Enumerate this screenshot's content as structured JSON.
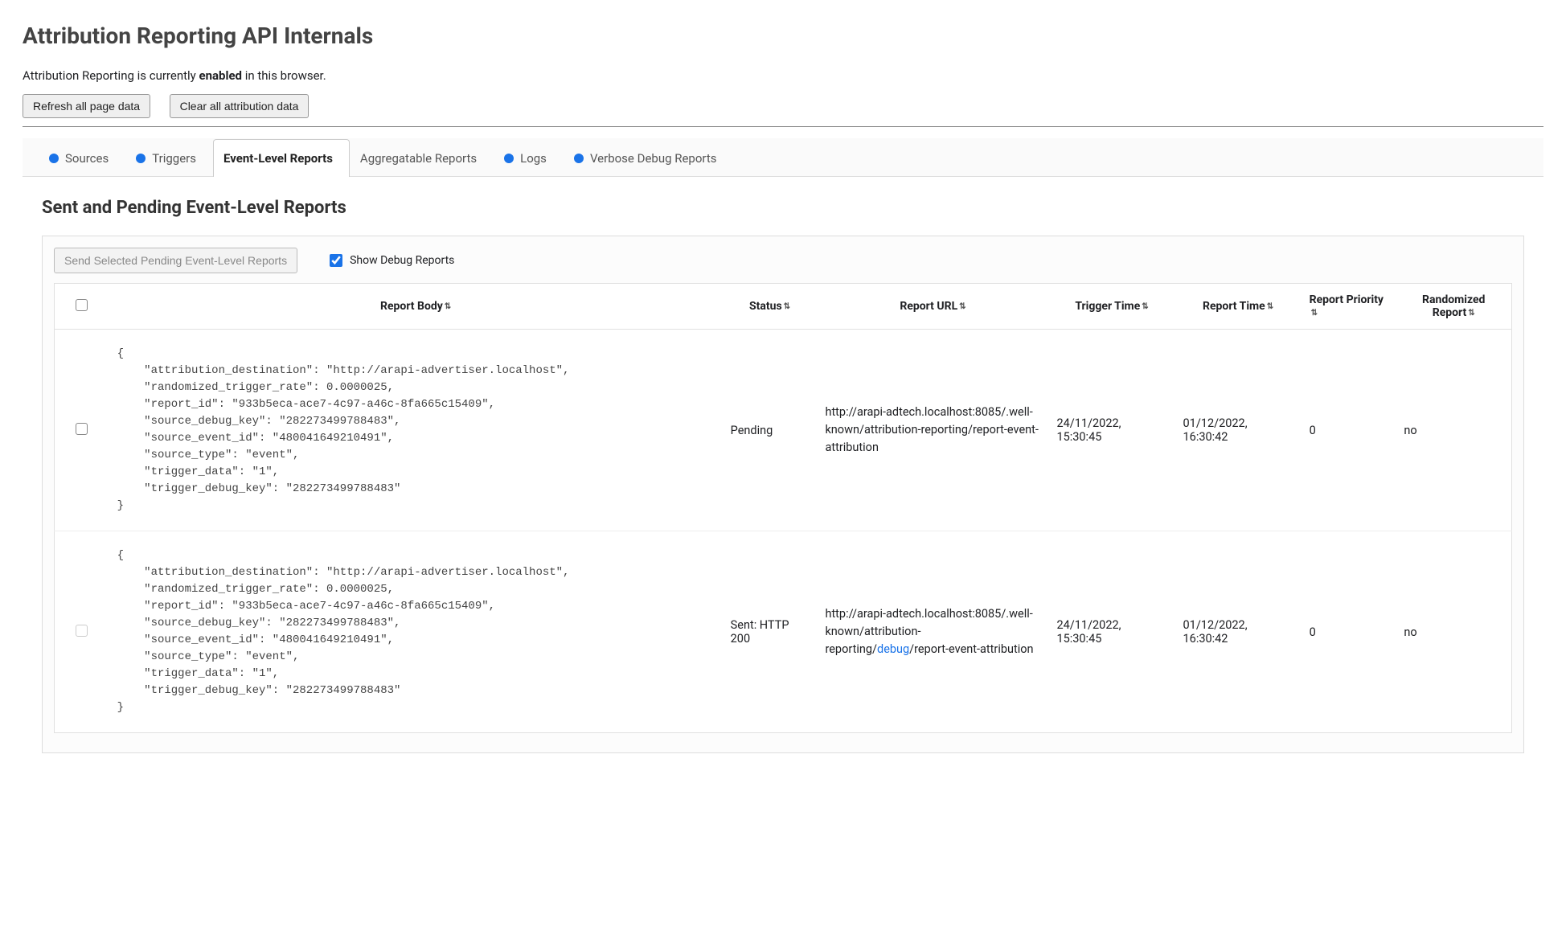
{
  "page": {
    "title": "Attribution Reporting API Internals",
    "status_prefix": "Attribution Reporting is currently ",
    "status_word": "enabled",
    "status_suffix": " in this browser.",
    "refresh_btn": "Refresh all page data",
    "clear_btn": "Clear all attribution data"
  },
  "tabs": {
    "sources": "Sources",
    "triggers": "Triggers",
    "event_reports": "Event-Level Reports",
    "agg_reports": "Aggregatable Reports",
    "logs": "Logs",
    "verbose": "Verbose Debug Reports"
  },
  "section": {
    "heading": "Sent and Pending Event-Level Reports",
    "send_btn": "Send Selected Pending Event-Level Reports",
    "show_debug_label": "Show Debug Reports"
  },
  "table": {
    "headers": {
      "body": "Report Body",
      "status": "Status",
      "url": "Report URL",
      "trigger_time": "Trigger Time",
      "report_time": "Report Time",
      "priority": "Report Priority",
      "randomized": "Randomized Report"
    },
    "rows": [
      {
        "checkbox_disabled": false,
        "body": "{\n    \"attribution_destination\": \"http://arapi-advertiser.localhost\",\n    \"randomized_trigger_rate\": 0.0000025,\n    \"report_id\": \"933b5eca-ace7-4c97-a46c-8fa665c15409\",\n    \"source_debug_key\": \"282273499788483\",\n    \"source_event_id\": \"480041649210491\",\n    \"source_type\": \"event\",\n    \"trigger_data\": \"1\",\n    \"trigger_debug_key\": \"282273499788483\"\n}",
        "status": "Pending",
        "url_pre": "http://arapi-adtech.localhost:8085/.well-known/attribution-reporting/report-event-attribution",
        "url_debug": "",
        "url_post": "",
        "trigger_time": "24/11/2022, 15:30:45",
        "report_time": "01/12/2022, 16:30:42",
        "priority": "0",
        "randomized": "no"
      },
      {
        "checkbox_disabled": true,
        "body": "{\n    \"attribution_destination\": \"http://arapi-advertiser.localhost\",\n    \"randomized_trigger_rate\": 0.0000025,\n    \"report_id\": \"933b5eca-ace7-4c97-a46c-8fa665c15409\",\n    \"source_debug_key\": \"282273499788483\",\n    \"source_event_id\": \"480041649210491\",\n    \"source_type\": \"event\",\n    \"trigger_data\": \"1\",\n    \"trigger_debug_key\": \"282273499788483\"\n}",
        "status": "Sent: HTTP 200",
        "url_pre": "http://arapi-adtech.localhost:8085/.well-known/attribution-reporting/",
        "url_debug": "debug",
        "url_post": "/report-event-attribution",
        "trigger_time": "24/11/2022, 15:30:45",
        "report_time": "01/12/2022, 16:30:42",
        "priority": "0",
        "randomized": "no"
      }
    ]
  }
}
